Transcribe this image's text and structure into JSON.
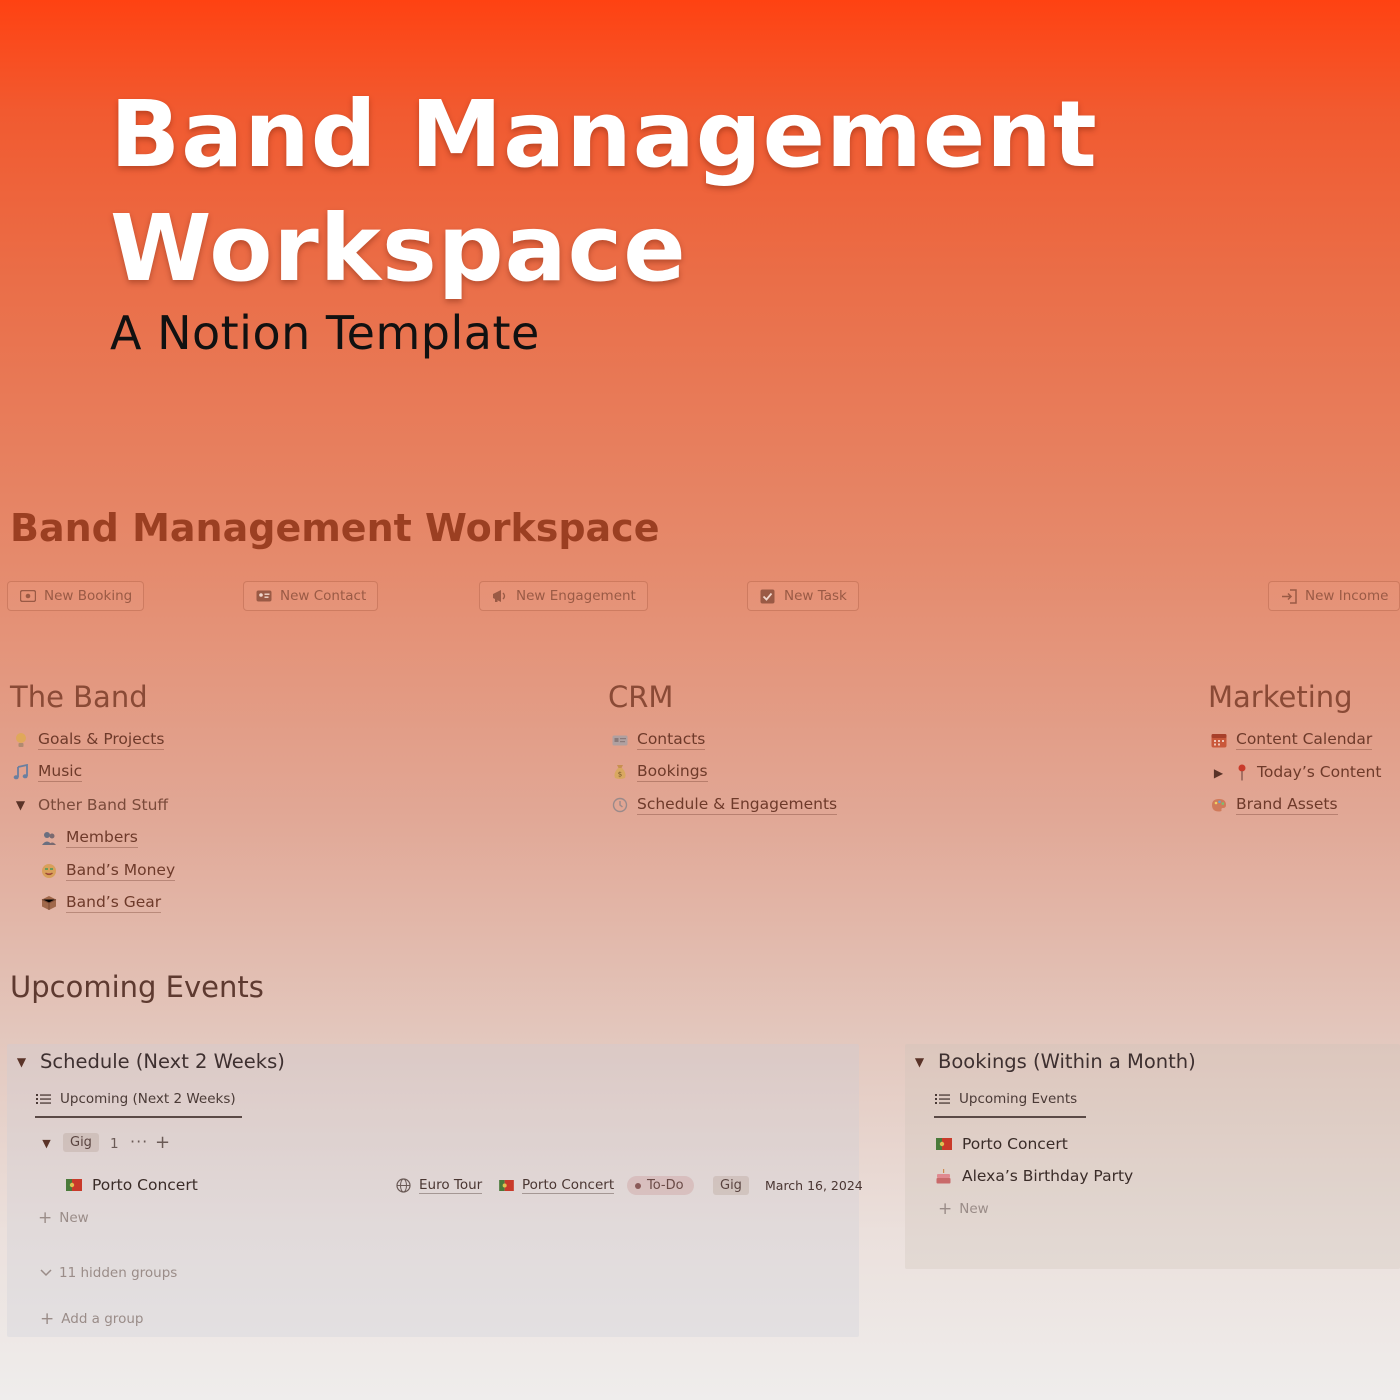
{
  "hero": {
    "title_line1": "Band Management",
    "title_line2": "Workspace",
    "subtitle": "A Notion Template"
  },
  "workspace": {
    "title": "Band Management Workspace",
    "buttons": [
      {
        "label": "New Booking",
        "icon": "money-icon"
      },
      {
        "label": "New Contact",
        "icon": "id-card-icon"
      },
      {
        "label": "New Engagement",
        "icon": "megaphone-icon"
      },
      {
        "label": "New Task",
        "icon": "checkbox-icon"
      },
      {
        "label": "New Income",
        "icon": "sign-in-icon"
      }
    ]
  },
  "columns": {
    "band": {
      "heading": "The Band",
      "items": [
        {
          "label": "Goals & Projects",
          "icon": "lightbulb-icon"
        },
        {
          "label": "Music",
          "icon": "music-note-icon"
        },
        {
          "label": "Other Band Stuff",
          "icon": "caret-down-icon"
        },
        {
          "label": "Members",
          "icon": "people-icon"
        },
        {
          "label": "Band’s Money",
          "icon": "money-face-icon"
        },
        {
          "label": "Band’s Gear",
          "icon": "box-icon"
        }
      ]
    },
    "crm": {
      "heading": "CRM",
      "items": [
        {
          "label": "Contacts",
          "icon": "id-card-icon"
        },
        {
          "label": "Bookings",
          "icon": "money-bag-icon"
        },
        {
          "label": "Schedule & Engagements",
          "icon": "clock-icon"
        }
      ]
    },
    "marketing": {
      "heading": "Marketing",
      "items": [
        {
          "label": "Content Calendar",
          "icon": "calendar-icon"
        },
        {
          "label": "Today’s Content",
          "icon": "pin-icon"
        },
        {
          "label": "Brand Assets",
          "icon": "palette-icon"
        }
      ]
    }
  },
  "upcoming": {
    "heading": "Upcoming Events",
    "schedule": {
      "title": "Schedule (Next 2 Weeks)",
      "tab": "Upcoming (Next 2 Weeks)",
      "group": {
        "name": "Gig",
        "count": "1"
      },
      "row": {
        "title": "Porto Concert",
        "tour": "Euro Tour",
        "booking": "Porto Concert",
        "status": "To-Do",
        "type": "Gig",
        "date": "March 16, 2024"
      },
      "new_label": "New",
      "hidden_groups": "11 hidden groups",
      "add_group": "Add a group"
    },
    "bookings": {
      "title": "Bookings (Within a Month)",
      "tab": "Upcoming Events",
      "rows": [
        "Porto Concert",
        "Alexa’s Birthday Party"
      ],
      "new_label": "New"
    }
  },
  "colors": {
    "hero_gradient_top": "#ff4212",
    "hero_gradient_bottom": "#efedec",
    "workspace_title": "#9b3f22"
  }
}
